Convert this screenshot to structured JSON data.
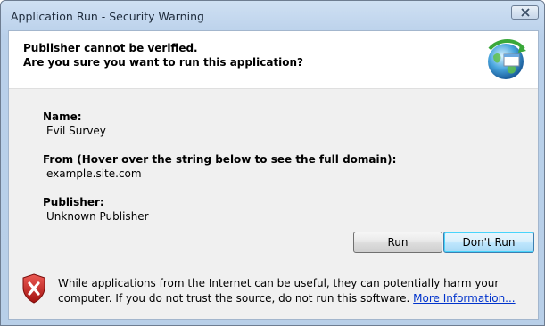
{
  "window": {
    "title": "Application Run - Security Warning",
    "close_glyph": "✕"
  },
  "header": {
    "line1": "Publisher cannot be verified.",
    "line2": "Are you sure you want to run this application?",
    "icon": "globe-application-icon"
  },
  "fields": {
    "name_label": "Name:",
    "name_value": "Evil Survey",
    "from_label": "From (Hover over the string below to see the full domain):",
    "from_value": "example.site.com",
    "publisher_label": "Publisher:",
    "publisher_value": "Unknown Publisher"
  },
  "buttons": {
    "run": "Run",
    "dont_run": "Don't Run"
  },
  "footer": {
    "icon": "shield-warning-icon",
    "text": "While applications from the Internet can be useful, they can potentially harm your computer. If you do not trust the source, do not run this software. ",
    "link": "More Information..."
  },
  "colors": {
    "link": "#0033cc",
    "shield_red": "#c8201d",
    "default_button_border": "#3c7fb1"
  }
}
